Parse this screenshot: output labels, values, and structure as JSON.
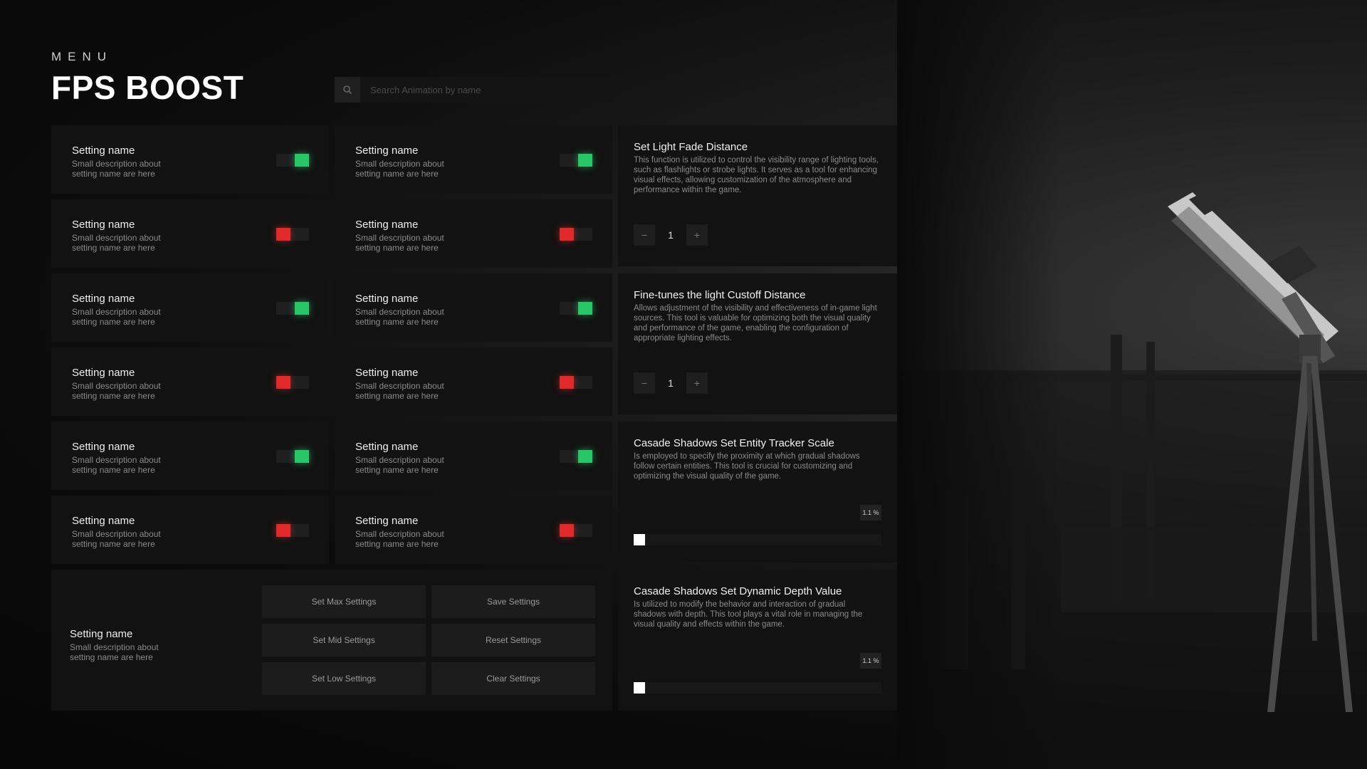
{
  "header": {
    "menu_label": "MENU",
    "title": "FPS BOOST"
  },
  "search": {
    "placeholder": "Search Animation by name"
  },
  "settings": [
    {
      "name": "Setting name",
      "desc": "Small description about setting name are here",
      "on": true
    },
    {
      "name": "Setting name",
      "desc": "Small description about setting name are here",
      "on": true
    },
    {
      "name": "Setting name",
      "desc": "Small description about setting name are here",
      "on": false
    },
    {
      "name": "Setting name",
      "desc": "Small description about setting name are here",
      "on": false
    },
    {
      "name": "Setting name",
      "desc": "Small description about setting name are here",
      "on": true
    },
    {
      "name": "Setting name",
      "desc": "Small description about setting name are here",
      "on": true
    },
    {
      "name": "Setting name",
      "desc": "Small description about setting name are here",
      "on": false
    },
    {
      "name": "Setting name",
      "desc": "Small description about setting name are here",
      "on": false
    },
    {
      "name": "Setting name",
      "desc": "Small description about setting name are here",
      "on": true
    },
    {
      "name": "Setting name",
      "desc": "Small description about setting name are here",
      "on": true
    },
    {
      "name": "Setting name",
      "desc": "Small description about setting name are here",
      "on": false
    },
    {
      "name": "Setting name",
      "desc": "Small description about setting name are here",
      "on": false
    }
  ],
  "presets": {
    "name": "Setting name",
    "desc": "Small description about setting name are here",
    "buttons": {
      "set_max": "Set Max Settings",
      "save": "Save Settings",
      "set_mid": "Set Mid Settings",
      "reset": "Reset Settings",
      "set_low": "Set Low Settings",
      "clear": "Clear Settings"
    }
  },
  "panels": {
    "light_fade": {
      "title": "Set Light Fade Distance",
      "desc": "This function is utilized to control the visibility range of lighting tools, such as flashlights or strobe lights. It serves as a tool for enhancing visual effects, allowing customization of the atmosphere and performance within the game.",
      "value": "1",
      "minus": "−",
      "plus": "+"
    },
    "light_cutoff": {
      "title": "Fine-tunes the light Custoff Distance",
      "desc": "Allows adjustment of the visibility and effectiveness of in-game light sources. This tool is valuable for optimizing both the visual quality and performance of the game, enabling the configuration of appropriate lighting effects.",
      "value": "1",
      "minus": "−",
      "plus": "+"
    },
    "entity_tracker": {
      "title": "Casade Shadows Set Entity Tracker Scale",
      "desc": "Is employed to specify the proximity at which gradual shadows follow certain entities. This tool is crucial for customizing and optimizing the visual quality of the game.",
      "badge": "1.1 %",
      "level": 0.011
    },
    "dynamic_depth": {
      "title": "Casade Shadows Set Dynamic Depth Value",
      "desc": "Is utilized to modify the behavior and interaction of gradual shadows with depth. This tool plays a vital role in managing the visual quality and effects within the game.",
      "badge": "1.1 %",
      "level": 0.011
    }
  },
  "colors": {
    "on": "#28c667",
    "off": "#e02a2a",
    "card": "#121212"
  }
}
